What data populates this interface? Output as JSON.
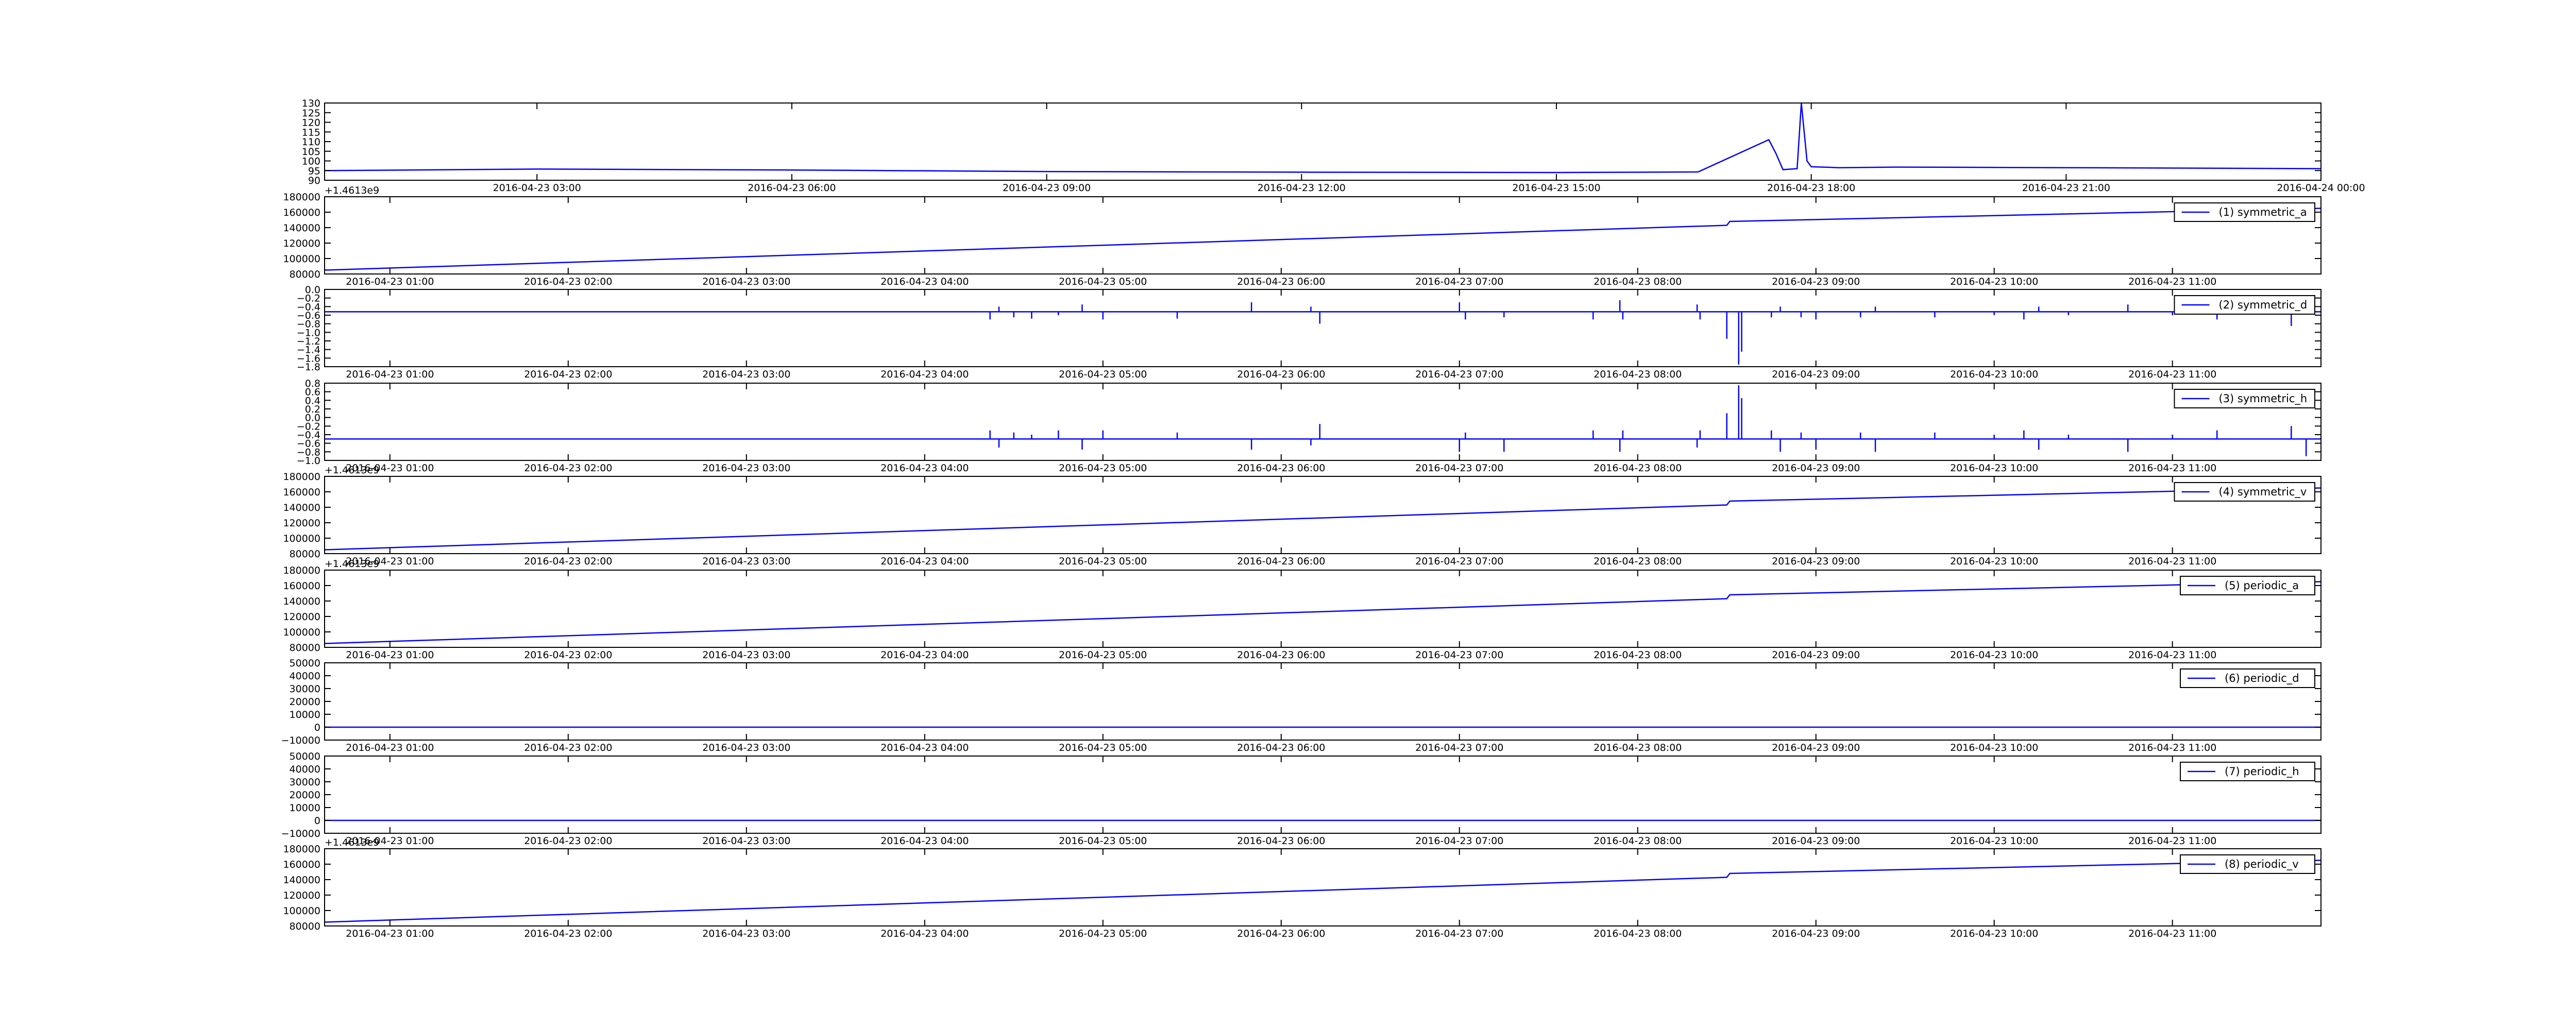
{
  "chart_data": [
    {
      "type": "line",
      "title": "",
      "xlabel": "",
      "ylabel": "",
      "x_ticks": [
        "2016-04-23 03:00",
        "2016-04-23 06:00",
        "2016-04-23 09:00",
        "2016-04-23 12:00",
        "2016-04-23 15:00",
        "2016-04-23 18:00",
        "2016-04-23 21:00",
        "2016-04-24 00:00"
      ],
      "xlim": [
        "2016-04-23 00:30",
        "2016-04-24 00:00"
      ],
      "y_ticks": [
        "90",
        "95",
        "100",
        "105",
        "110",
        "115",
        "120",
        "125",
        "130"
      ],
      "ylim": [
        90,
        130
      ],
      "offset_text": "",
      "legend": null,
      "series": [
        {
          "name": "",
          "color": "#0000ff",
          "x": [
            "2016-04-23 00:30",
            "2016-04-23 03:00",
            "2016-04-23 06:00",
            "2016-04-23 09:00",
            "2016-04-23 12:00",
            "2016-04-23 15:00",
            "2016-04-23 16:40",
            "2016-04-23 17:30",
            "2016-04-23 17:35",
            "2016-04-23 17:40",
            "2016-04-23 17:50",
            "2016-04-23 17:53",
            "2016-04-23 17:57",
            "2016-04-23 18:00",
            "2016-04-23 18:20",
            "2016-04-23 19:00",
            "2016-04-23 21:00",
            "2016-04-24 00:00"
          ],
          "y": [
            95.0,
            95.8,
            95.3,
            94.5,
            94.2,
            94.0,
            94.3,
            111.0,
            104.0,
            95.5,
            96.0,
            130.0,
            100.0,
            97.0,
            96.5,
            96.8,
            96.5,
            96.0
          ]
        }
      ]
    },
    {
      "type": "line",
      "title": "",
      "xlabel": "",
      "ylabel": "",
      "x_ticks": [
        "2016-04-23 01:00",
        "2016-04-23 02:00",
        "2016-04-23 03:00",
        "2016-04-23 04:00",
        "2016-04-23 05:00",
        "2016-04-23 06:00",
        "2016-04-23 07:00",
        "2016-04-23 08:00",
        "2016-04-23 09:00",
        "2016-04-23 10:00",
        "2016-04-23 11:00"
      ],
      "xlim": [
        "2016-04-23 00:38",
        "2016-04-23 11:50"
      ],
      "y_ticks": [
        "80000",
        "100000",
        "120000",
        "140000",
        "160000",
        "180000"
      ],
      "ylim": [
        80000,
        180000
      ],
      "offset_text": "+1.4613e9",
      "legend": {
        "label": "(1) symmetric_a",
        "loc": "upper right"
      },
      "series": [
        {
          "name": "(1) symmetric_a",
          "color": "#0000ff",
          "x": [
            "2016-04-23 00:38",
            "2016-04-23 08:30",
            "2016-04-23 08:31",
            "2016-04-23 11:50"
          ],
          "y": [
            85000,
            143000,
            148000,
            165000
          ]
        }
      ]
    },
    {
      "type": "line",
      "title": "",
      "xlabel": "",
      "ylabel": "",
      "x_ticks": [
        "2016-04-23 01:00",
        "2016-04-23 02:00",
        "2016-04-23 03:00",
        "2016-04-23 04:00",
        "2016-04-23 05:00",
        "2016-04-23 06:00",
        "2016-04-23 07:00",
        "2016-04-23 08:00",
        "2016-04-23 09:00",
        "2016-04-23 10:00",
        "2016-04-23 11:00"
      ],
      "xlim": [
        "2016-04-23 00:38",
        "2016-04-23 11:50"
      ],
      "y_ticks": [
        "−1.8",
        "−1.6",
        "−1.4",
        "−1.2",
        "−1.0",
        "−0.8",
        "−0.6",
        "−0.4",
        "−0.2",
        "0.0"
      ],
      "ylim": [
        -1.8,
        0.0
      ],
      "offset_text": "",
      "legend": {
        "label": "(2) symmetric_d",
        "loc": "upper right"
      },
      "baseline": -0.52,
      "spikes": [
        [
          "2016-04-23 04:22",
          -0.7
        ],
        [
          "2016-04-23 04:25",
          -0.4
        ],
        [
          "2016-04-23 04:30",
          -0.65
        ],
        [
          "2016-04-23 04:36",
          -0.68
        ],
        [
          "2016-04-23 04:45",
          -0.6
        ],
        [
          "2016-04-23 04:53",
          -0.35
        ],
        [
          "2016-04-23 05:00",
          -0.7
        ],
        [
          "2016-04-23 05:25",
          -0.68
        ],
        [
          "2016-04-23 05:50",
          -0.3
        ],
        [
          "2016-04-23 06:10",
          -0.4
        ],
        [
          "2016-04-23 06:13",
          -0.8
        ],
        [
          "2016-04-23 07:00",
          -0.3
        ],
        [
          "2016-04-23 07:02",
          -0.7
        ],
        [
          "2016-04-23 07:15",
          -0.65
        ],
        [
          "2016-04-23 07:45",
          -0.7
        ],
        [
          "2016-04-23 07:54",
          -0.25
        ],
        [
          "2016-04-23 07:55",
          -0.7
        ],
        [
          "2016-04-23 08:20",
          -0.35
        ],
        [
          "2016-04-23 08:21",
          -0.7
        ],
        [
          "2016-04-23 08:30",
          -1.15
        ],
        [
          "2016-04-23 08:34",
          -1.75
        ],
        [
          "2016-04-23 08:35",
          -1.45
        ],
        [
          "2016-04-23 08:45",
          -0.65
        ],
        [
          "2016-04-23 08:48",
          -0.4
        ],
        [
          "2016-04-23 08:55",
          -0.65
        ],
        [
          "2016-04-23 09:00",
          -0.7
        ],
        [
          "2016-04-23 09:15",
          -0.65
        ],
        [
          "2016-04-23 09:20",
          -0.4
        ],
        [
          "2016-04-23 09:40",
          -0.65
        ],
        [
          "2016-04-23 10:00",
          -0.6
        ],
        [
          "2016-04-23 10:10",
          -0.7
        ],
        [
          "2016-04-23 10:15",
          -0.4
        ],
        [
          "2016-04-23 10:25",
          -0.6
        ],
        [
          "2016-04-23 10:45",
          -0.35
        ],
        [
          "2016-04-23 11:00",
          -0.6
        ],
        [
          "2016-04-23 11:15",
          -0.7
        ],
        [
          "2016-04-23 11:40",
          -0.85
        ],
        [
          "2016-04-23 11:45",
          -0.4
        ]
      ]
    },
    {
      "type": "line",
      "title": "",
      "xlabel": "",
      "ylabel": "",
      "x_ticks": [
        "2016-04-23 01:00",
        "2016-04-23 02:00",
        "2016-04-23 03:00",
        "2016-04-23 04:00",
        "2016-04-23 05:00",
        "2016-04-23 06:00",
        "2016-04-23 07:00",
        "2016-04-23 08:00",
        "2016-04-23 09:00",
        "2016-04-23 10:00",
        "2016-04-23 11:00"
      ],
      "xlim": [
        "2016-04-23 00:38",
        "2016-04-23 11:50"
      ],
      "y_ticks": [
        "−1.0",
        "−0.8",
        "−0.6",
        "−0.4",
        "−0.2",
        "0.0",
        "0.2",
        "0.4",
        "0.6",
        "0.8"
      ],
      "ylim": [
        -1.0,
        0.8
      ],
      "offset_text": "",
      "legend": {
        "label": "(3) symmetric_h",
        "loc": "upper right"
      },
      "baseline": -0.5,
      "spikes": [
        [
          "2016-04-23 04:22",
          -0.3
        ],
        [
          "2016-04-23 04:25",
          -0.7
        ],
        [
          "2016-04-23 04:30",
          -0.35
        ],
        [
          "2016-04-23 04:36",
          -0.4
        ],
        [
          "2016-04-23 04:45",
          -0.3
        ],
        [
          "2016-04-23 04:53",
          -0.75
        ],
        [
          "2016-04-23 05:00",
          -0.3
        ],
        [
          "2016-04-23 05:25",
          -0.35
        ],
        [
          "2016-04-23 05:50",
          -0.75
        ],
        [
          "2016-04-23 06:10",
          -0.65
        ],
        [
          "2016-04-23 06:13",
          -0.15
        ],
        [
          "2016-04-23 07:00",
          -0.8
        ],
        [
          "2016-04-23 07:02",
          -0.35
        ],
        [
          "2016-04-23 07:15",
          -0.8
        ],
        [
          "2016-04-23 07:45",
          -0.3
        ],
        [
          "2016-04-23 07:54",
          -0.8
        ],
        [
          "2016-04-23 07:55",
          -0.3
        ],
        [
          "2016-04-23 08:20",
          -0.7
        ],
        [
          "2016-04-23 08:21",
          -0.3
        ],
        [
          "2016-04-23 08:30",
          0.1
        ],
        [
          "2016-04-23 08:34",
          0.75
        ],
        [
          "2016-04-23 08:35",
          0.45
        ],
        [
          "2016-04-23 08:45",
          -0.3
        ],
        [
          "2016-04-23 08:48",
          -0.8
        ],
        [
          "2016-04-23 08:55",
          -0.35
        ],
        [
          "2016-04-23 09:00",
          -0.75
        ],
        [
          "2016-04-23 09:15",
          -0.35
        ],
        [
          "2016-04-23 09:20",
          -0.8
        ],
        [
          "2016-04-23 09:40",
          -0.35
        ],
        [
          "2016-04-23 10:00",
          -0.4
        ],
        [
          "2016-04-23 10:10",
          -0.3
        ],
        [
          "2016-04-23 10:15",
          -0.75
        ],
        [
          "2016-04-23 10:25",
          -0.4
        ],
        [
          "2016-04-23 10:45",
          -0.8
        ],
        [
          "2016-04-23 11:00",
          -0.4
        ],
        [
          "2016-04-23 11:15",
          -0.3
        ],
        [
          "2016-04-23 11:40",
          -0.2
        ],
        [
          "2016-04-23 11:45",
          -0.9
        ]
      ]
    },
    {
      "type": "line",
      "title": "",
      "xlabel": "",
      "ylabel": "",
      "x_ticks": [
        "2016-04-23 01:00",
        "2016-04-23 02:00",
        "2016-04-23 03:00",
        "2016-04-23 04:00",
        "2016-04-23 05:00",
        "2016-04-23 06:00",
        "2016-04-23 07:00",
        "2016-04-23 08:00",
        "2016-04-23 09:00",
        "2016-04-23 10:00",
        "2016-04-23 11:00"
      ],
      "xlim": [
        "2016-04-23 00:38",
        "2016-04-23 11:50"
      ],
      "y_ticks": [
        "80000",
        "100000",
        "120000",
        "140000",
        "160000",
        "180000"
      ],
      "ylim": [
        80000,
        180000
      ],
      "offset_text": "+1.4613e9",
      "legend": {
        "label": "(4) symmetric_v",
        "loc": "upper right"
      },
      "series": [
        {
          "name": "(4) symmetric_v",
          "color": "#0000ff",
          "x": [
            "2016-04-23 00:38",
            "2016-04-23 08:30",
            "2016-04-23 08:31",
            "2016-04-23 11:50"
          ],
          "y": [
            85000,
            143000,
            148000,
            165000
          ]
        }
      ]
    },
    {
      "type": "line",
      "title": "",
      "xlabel": "",
      "ylabel": "",
      "x_ticks": [
        "2016-04-23 01:00",
        "2016-04-23 02:00",
        "2016-04-23 03:00",
        "2016-04-23 04:00",
        "2016-04-23 05:00",
        "2016-04-23 06:00",
        "2016-04-23 07:00",
        "2016-04-23 08:00",
        "2016-04-23 09:00",
        "2016-04-23 10:00",
        "2016-04-23 11:00"
      ],
      "xlim": [
        "2016-04-23 00:38",
        "2016-04-23 11:50"
      ],
      "y_ticks": [
        "80000",
        "100000",
        "120000",
        "140000",
        "160000",
        "180000"
      ],
      "ylim": [
        80000,
        180000
      ],
      "offset_text": "+1.4613e9",
      "legend": {
        "label": "(5) periodic_a",
        "loc": "upper right"
      },
      "series": [
        {
          "name": "(5) periodic_a",
          "color": "#0000ff",
          "x": [
            "2016-04-23 00:38",
            "2016-04-23 08:30",
            "2016-04-23 08:31",
            "2016-04-23 11:50"
          ],
          "y": [
            85000,
            143000,
            148000,
            165000
          ]
        }
      ]
    },
    {
      "type": "line",
      "title": "",
      "xlabel": "",
      "ylabel": "",
      "x_ticks": [
        "2016-04-23 01:00",
        "2016-04-23 02:00",
        "2016-04-23 03:00",
        "2016-04-23 04:00",
        "2016-04-23 05:00",
        "2016-04-23 06:00",
        "2016-04-23 07:00",
        "2016-04-23 08:00",
        "2016-04-23 09:00",
        "2016-04-23 10:00",
        "2016-04-23 11:00"
      ],
      "xlim": [
        "2016-04-23 00:38",
        "2016-04-23 11:50"
      ],
      "y_ticks": [
        "−10000",
        "0",
        "10000",
        "20000",
        "30000",
        "40000",
        "50000"
      ],
      "ylim": [
        -10000,
        50000
      ],
      "offset_text": "",
      "legend": {
        "label": "(6) periodic_d",
        "loc": "upper right"
      },
      "series": [
        {
          "name": "(6) periodic_d",
          "color": "#0000ff",
          "x": [
            "2016-04-23 00:38",
            "2016-04-23 11:50"
          ],
          "y": [
            0,
            0
          ]
        }
      ]
    },
    {
      "type": "line",
      "title": "",
      "xlabel": "",
      "ylabel": "",
      "x_ticks": [
        "2016-04-23 01:00",
        "2016-04-23 02:00",
        "2016-04-23 03:00",
        "2016-04-23 04:00",
        "2016-04-23 05:00",
        "2016-04-23 06:00",
        "2016-04-23 07:00",
        "2016-04-23 08:00",
        "2016-04-23 09:00",
        "2016-04-23 10:00",
        "2016-04-23 11:00"
      ],
      "xlim": [
        "2016-04-23 00:38",
        "2016-04-23 11:50"
      ],
      "y_ticks": [
        "−10000",
        "0",
        "10000",
        "20000",
        "30000",
        "40000",
        "50000"
      ],
      "ylim": [
        -10000,
        50000
      ],
      "offset_text": "",
      "legend": {
        "label": "(7) periodic_h",
        "loc": "upper right"
      },
      "series": [
        {
          "name": "(7) periodic_h",
          "color": "#0000ff",
          "x": [
            "2016-04-23 00:38",
            "2016-04-23 11:50"
          ],
          "y": [
            0,
            0
          ]
        }
      ]
    },
    {
      "type": "line",
      "title": "",
      "xlabel": "",
      "ylabel": "",
      "x_ticks": [
        "2016-04-23 01:00",
        "2016-04-23 02:00",
        "2016-04-23 03:00",
        "2016-04-23 04:00",
        "2016-04-23 05:00",
        "2016-04-23 06:00",
        "2016-04-23 07:00",
        "2016-04-23 08:00",
        "2016-04-23 09:00",
        "2016-04-23 10:00",
        "2016-04-23 11:00"
      ],
      "xlim": [
        "2016-04-23 00:38",
        "2016-04-23 11:50"
      ],
      "y_ticks": [
        "80000",
        "100000",
        "120000",
        "140000",
        "160000",
        "180000"
      ],
      "ylim": [
        80000,
        180000
      ],
      "offset_text": "+1.4613e9",
      "legend": {
        "label": "(8) periodic_v",
        "loc": "upper right"
      },
      "series": [
        {
          "name": "(8) periodic_v",
          "color": "#0000ff",
          "x": [
            "2016-04-23 00:38",
            "2016-04-23 08:30",
            "2016-04-23 08:31",
            "2016-04-23 11:50"
          ],
          "y": [
            85000,
            143000,
            148000,
            165000
          ]
        }
      ]
    }
  ]
}
